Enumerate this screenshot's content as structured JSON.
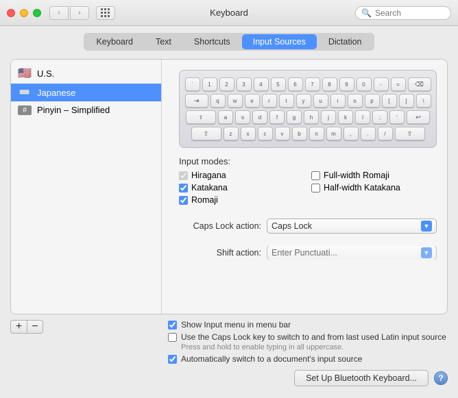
{
  "titleBar": {
    "title": "Keyboard",
    "search_placeholder": "Search"
  },
  "tabs": {
    "items": [
      {
        "id": "keyboard",
        "label": "Keyboard"
      },
      {
        "id": "text",
        "label": "Text"
      },
      {
        "id": "shortcuts",
        "label": "Shortcuts"
      },
      {
        "id": "input-sources",
        "label": "Input Sources"
      },
      {
        "id": "dictation",
        "label": "Dictation"
      }
    ],
    "active": "input-sources"
  },
  "sidebar": {
    "items": [
      {
        "id": "us",
        "flag": "🇺🇸",
        "label": "U.S.",
        "selected": false
      },
      {
        "id": "japanese",
        "flag": "⌨",
        "label": "Japanese",
        "selected": true
      },
      {
        "id": "pinyin",
        "flag": "#",
        "label": "Pinyin – Simplified",
        "selected": false
      }
    ]
  },
  "keyboard": {
    "rows": [
      [
        "`",
        "1",
        "2",
        "3",
        "4",
        "5",
        "6",
        "7",
        "8",
        "9",
        "0",
        "-",
        "=",
        "⌫"
      ],
      [
        "⇥",
        "q",
        "w",
        "e",
        "r",
        "t",
        "y",
        "u",
        "i",
        "o",
        "p",
        "[",
        "]",
        "\\"
      ],
      [
        "⇪",
        "a",
        "s",
        "d",
        "f",
        "g",
        "h",
        "j",
        "k",
        "l",
        ";",
        "'",
        "↩"
      ],
      [
        "⇧",
        "z",
        "x",
        "c",
        "v",
        "b",
        "n",
        "m",
        ",",
        ".",
        "/",
        " ⇧"
      ],
      [
        "",
        "",
        "",
        "",
        "",
        "",
        "",
        "",
        "",
        "",
        "",
        ""
      ]
    ]
  },
  "inputModes": {
    "label": "Input modes:",
    "items": [
      {
        "id": "hiragana",
        "label": "Hiragana",
        "checked": true,
        "disabled": true
      },
      {
        "id": "full-width-romaji",
        "label": "Full-width Romaji",
        "checked": false,
        "disabled": false
      },
      {
        "id": "katakana",
        "label": "Katakana",
        "checked": true,
        "disabled": false
      },
      {
        "id": "half-width-katakana",
        "label": "Half-width Katakana",
        "checked": false,
        "disabled": false
      },
      {
        "id": "romaji",
        "label": "Romaji",
        "checked": true,
        "disabled": false
      }
    ]
  },
  "capsLockAction": {
    "label": "Caps Lock action:",
    "value": "Caps Lock"
  },
  "shiftAction": {
    "label": "Shift action:",
    "value": "Enter Punctuation..."
  },
  "bottomOptions": [
    {
      "id": "show-input-menu",
      "label": "Show Input menu in menu bar",
      "checked": true,
      "subtext": null
    },
    {
      "id": "caps-lock-switch",
      "label": "Use the Caps Lock key to switch to and from last used Latin input source",
      "checked": false,
      "subtext": "Press and hold to enable typing in all uppercase."
    },
    {
      "id": "auto-switch",
      "label": "Automatically switch to a document's input source",
      "checked": true,
      "subtext": null
    }
  ],
  "buttons": {
    "setup_bluetooth": "Set Up Bluetooth Keyboard...",
    "help": "?"
  },
  "addRemove": {
    "add": "+",
    "remove": "−"
  }
}
